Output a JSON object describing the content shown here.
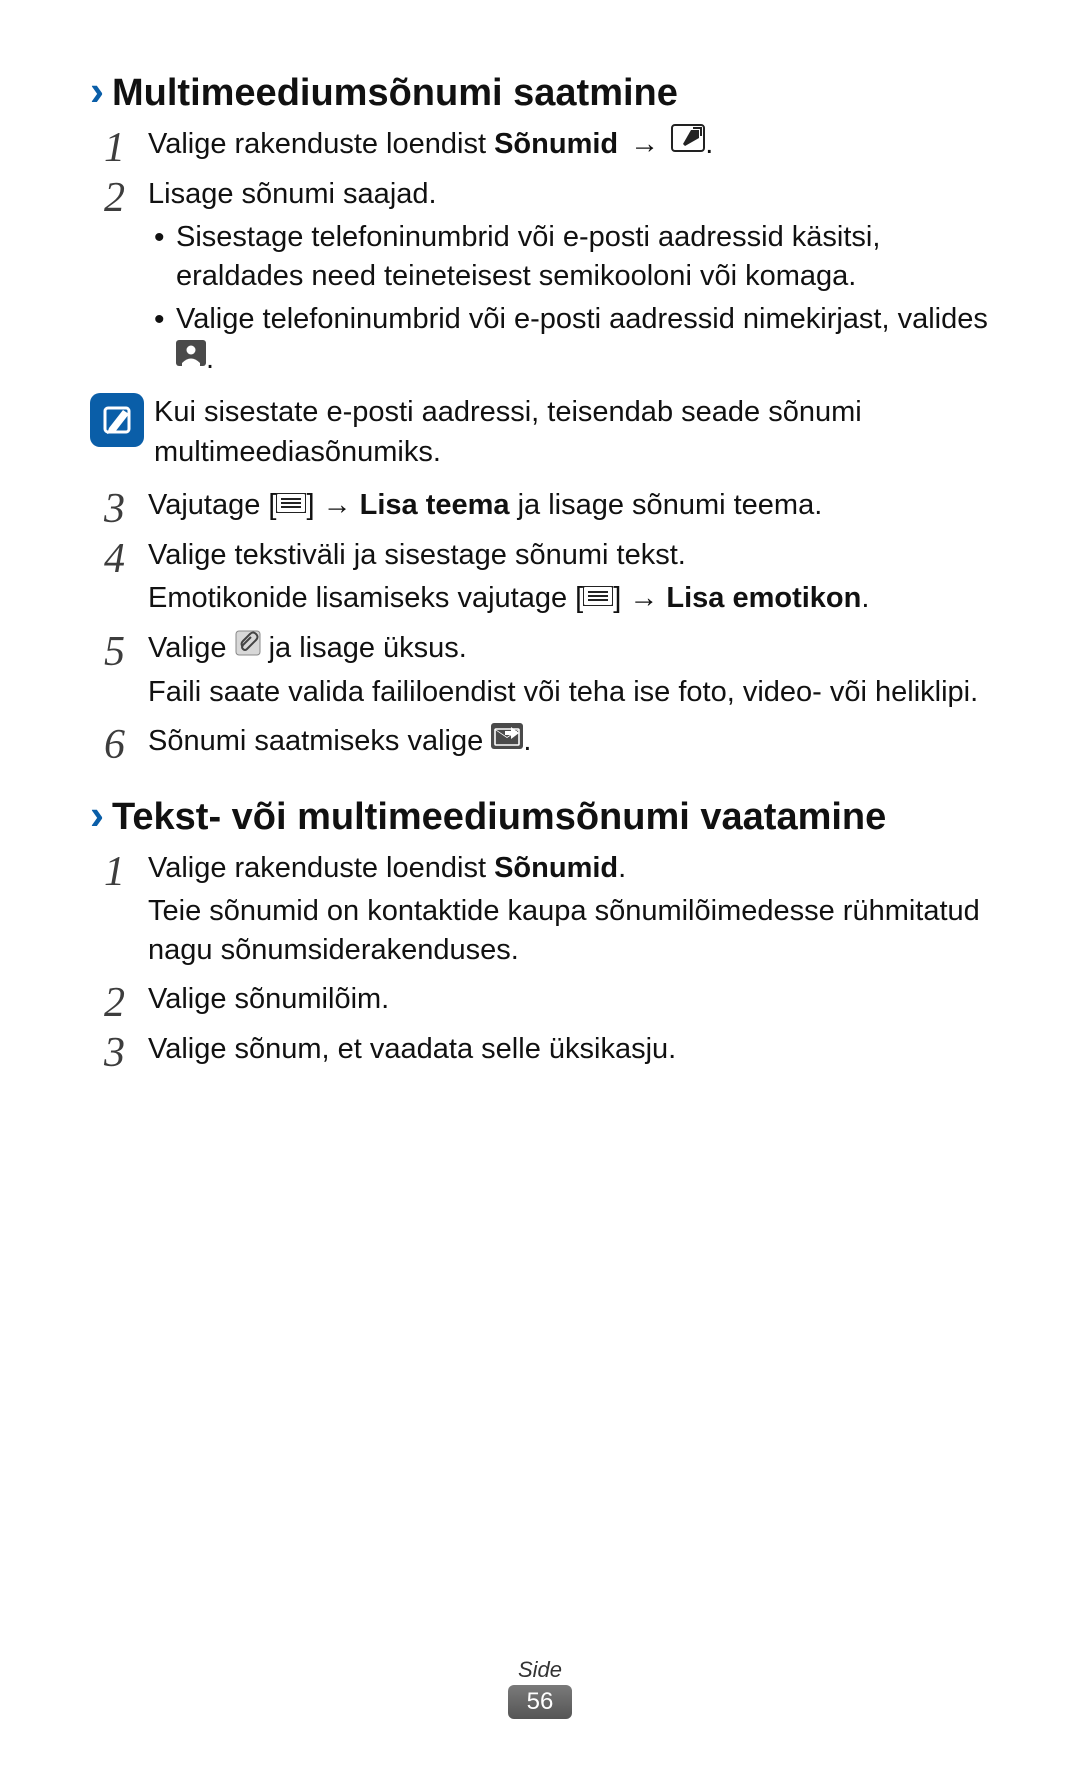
{
  "section1": {
    "title": "Multimeediumsõnumi saatmine",
    "steps": {
      "s1": {
        "num": "1",
        "t1": "Valige rakenduste loendist ",
        "b1": "Sõnumid",
        "arrow": " → ",
        "period": "."
      },
      "s2": {
        "num": "2",
        "t1": "Lisage sõnumi saajad.",
        "b1": "Sisestage telefoninumbrid või e-posti aadressid käsitsi, eraldades need teineteisest semikooloni või komaga.",
        "b2a": "Valige telefoninumbrid või e-posti aadressid nimekirjast, valides ",
        "b2b": "."
      },
      "note": "Kui sisestate e-posti aadressi, teisendab seade sõnumi multimeediasõnumiks.",
      "s3": {
        "num": "3",
        "t1": "Vajutage [",
        "t2": "] → ",
        "b1": "Lisa teema",
        "t3": " ja lisage sõnumi teema."
      },
      "s4": {
        "num": "4",
        "l1": "Valige tekstiväli ja sisestage sõnumi tekst.",
        "l2a": "Emotikonide lisamiseks vajutage [",
        "l2b": "] → ",
        "l2bold": "Lisa emotikon",
        "l2c": "."
      },
      "s5": {
        "num": "5",
        "t1": "Valige ",
        "t2": " ja lisage üksus.",
        "l2": "Faili saate valida faililoendist või teha ise foto, video- või heliklipi."
      },
      "s6": {
        "num": "6",
        "t1": "Sõnumi saatmiseks valige ",
        "t2": "."
      }
    }
  },
  "section2": {
    "title": "Tekst- või multimeediumsõnumi vaatamine",
    "steps": {
      "s1": {
        "num": "1",
        "t1": "Valige rakenduste loendist ",
        "b1": "Sõnumid",
        "t2": ".",
        "l2": "Teie sõnumid on kontaktide kaupa sõnumilõimedesse rühmitatud nagu sõnumsiderakenduses."
      },
      "s2": {
        "num": "2",
        "t1": "Valige sõnumilõim."
      },
      "s3": {
        "num": "3",
        "t1": "Valige sõnum, et vaadata selle üksikasju."
      }
    }
  },
  "footer": {
    "label": "Side",
    "page": "56"
  }
}
